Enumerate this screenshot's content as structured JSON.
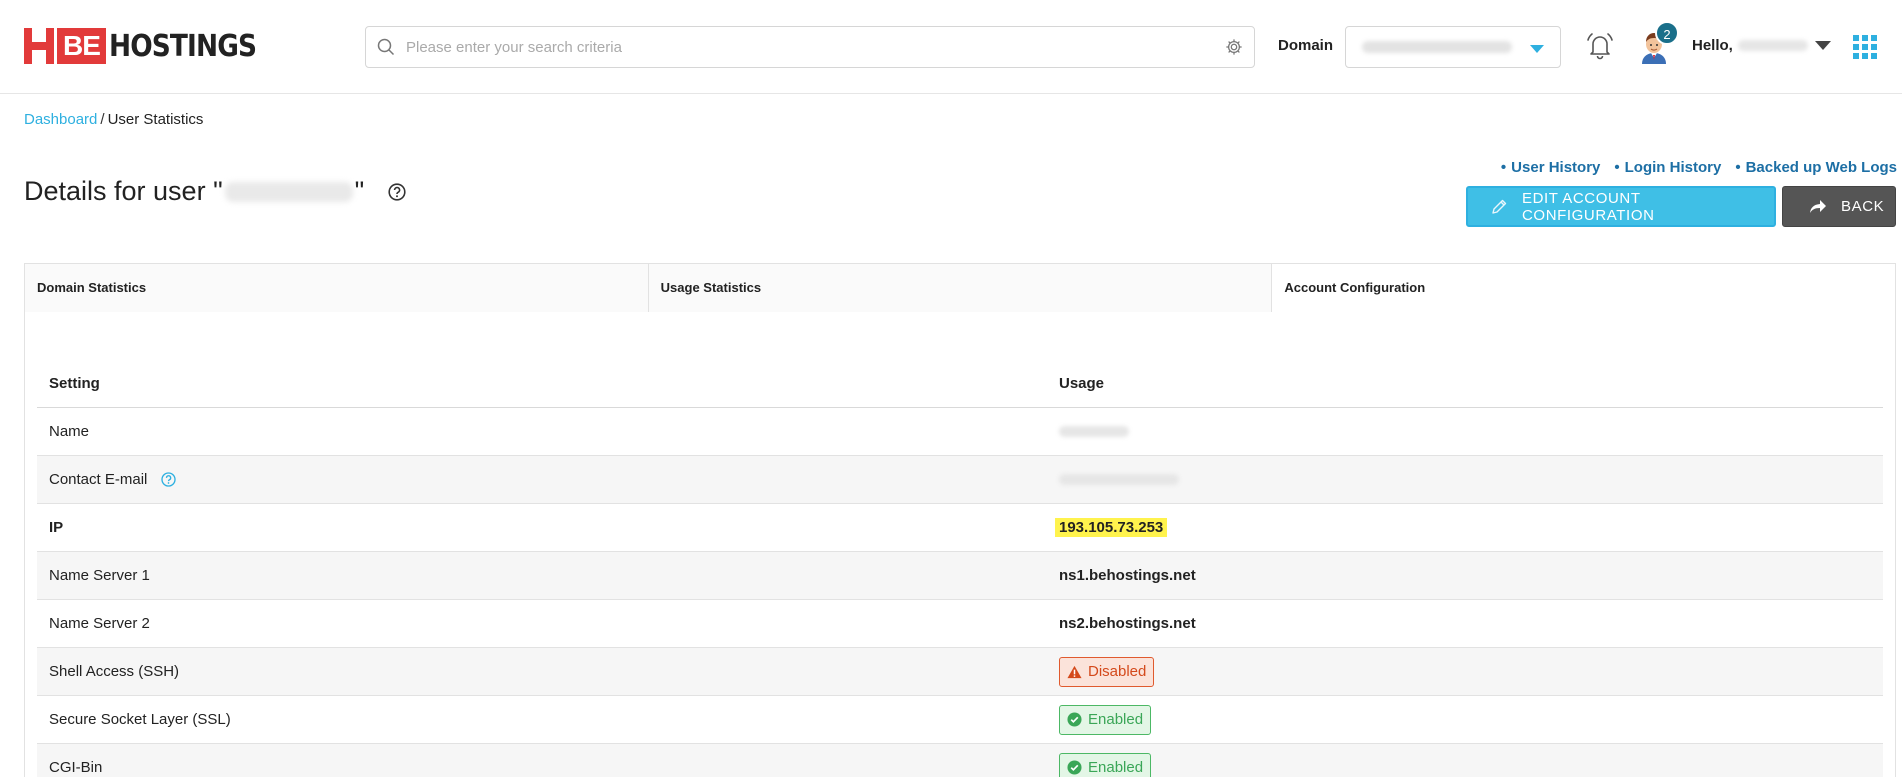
{
  "header": {
    "logo_brand": "BE",
    "logo_text": "HOSTINGS",
    "search_placeholder": "Please enter your search criteria",
    "domain_label": "Domain",
    "notification_count": "2",
    "greeting": "Hello,"
  },
  "breadcrumb": {
    "root": "Dashboard",
    "separator": "/",
    "current": "User Statistics"
  },
  "page": {
    "title_prefix": "Details for user \"",
    "title_suffix": "\""
  },
  "links": [
    "User History",
    "Login History",
    "Backed up Web Logs"
  ],
  "buttons": {
    "edit": "EDIT ACCOUNT CONFIGURATION",
    "back": "BACK"
  },
  "tabs": [
    {
      "label": "Domain Statistics",
      "active": false
    },
    {
      "label": "Usage Statistics",
      "active": false
    },
    {
      "label": "Account Configuration",
      "active": true
    }
  ],
  "table": {
    "headers": {
      "setting": "Setting",
      "usage": "Usage"
    },
    "rows": [
      {
        "setting": "Name",
        "value": ""
      },
      {
        "setting": "Contact E-mail",
        "value": ""
      },
      {
        "setting": "IP",
        "value": "193.105.73.253"
      },
      {
        "setting": "Name Server 1",
        "value": "ns1.behostings.net"
      },
      {
        "setting": "Name Server 2",
        "value": "ns2.behostings.net"
      },
      {
        "setting": "Shell Access (SSH)",
        "value": "Disabled"
      },
      {
        "setting": "Secure Socket Layer (SSL)",
        "value": "Enabled"
      },
      {
        "setting": "CGI-Bin",
        "value": "Enabled"
      }
    ]
  },
  "colors": {
    "accent": "#2eb0e0",
    "brand_red": "#e23a3a",
    "link_blue": "#1d6fa5",
    "disabled": "#d4491b",
    "enabled": "#3aa657",
    "highlight": "#fff34d"
  }
}
